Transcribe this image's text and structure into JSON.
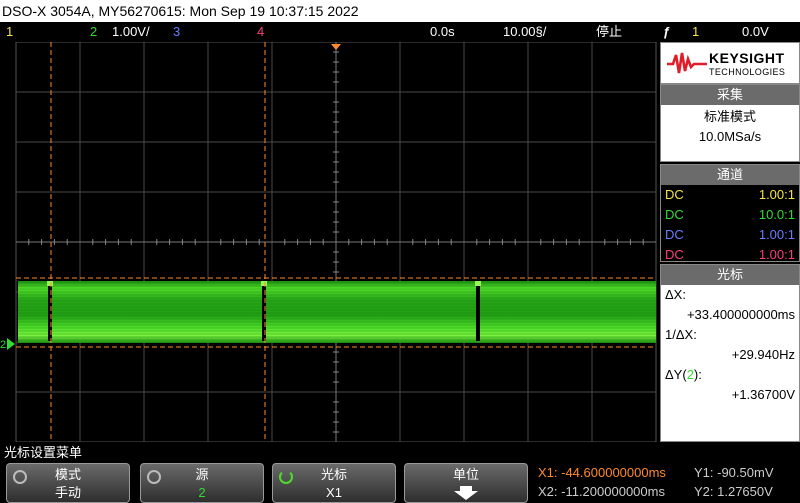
{
  "title_bar": "DSO-X 3054A, MY56270615: Mon Sep 19 10:37:15 2022",
  "status_bar": {
    "ch1": "1",
    "ch2": "2",
    "ch2_scale": "1.00V/",
    "ch3": "3",
    "ch4": "4",
    "delay": "0.0s",
    "timebase": "10.00§/",
    "run_state": "停止",
    "trigger_source": "1",
    "trigger_level": "0.0V"
  },
  "colors": {
    "ch1": "#f5e642",
    "ch2": "#2fdc2f",
    "ch3": "#6a7dff",
    "ch4": "#ff3c7f",
    "cursor": "#ff8a2a",
    "trigger_marker": "#ff8a2a"
  },
  "brand": {
    "name": "KEYSIGHT",
    "sub": "TECHNOLOGIES"
  },
  "acquisition": {
    "header": "采集",
    "mode": "标准模式",
    "rate": "10.0MSa/s"
  },
  "channels": {
    "header": "通道",
    "rows": [
      {
        "coupling": "DC",
        "probe": "1.00:1"
      },
      {
        "coupling": "DC",
        "probe": "10.0:1"
      },
      {
        "coupling": "DC",
        "probe": "1.00:1"
      },
      {
        "coupling": "DC",
        "probe": "1.00:1"
      }
    ]
  },
  "cursors": {
    "header": "光标",
    "dx_label": "ΔX:",
    "dx_value": "+33.400000000ms",
    "inv_dx_label": "1/ΔX:",
    "inv_dx_value": "+29.940Hz",
    "dy_label_prefix": "ΔY(",
    "dy_channel": "2",
    "dy_label_suffix": "):",
    "dy_value": "+1.36700V"
  },
  "menu_caption": "光标设置菜单",
  "softkeys": [
    {
      "label": "模式",
      "value": "手动",
      "icon": "rotate-knob-icon"
    },
    {
      "label": "源",
      "value": "2",
      "icon": "rotate-knob-icon"
    },
    {
      "label": "光标",
      "value": "X1",
      "icon": "rotate-knob-icon"
    },
    {
      "label": "单位",
      "value": "",
      "icon": "down-arrow-icon"
    }
  ],
  "cursor_readout": {
    "x1": "X1: -44.600000000ms",
    "x2": "X2: -11.200000000ms",
    "y1": "Y1: -90.50mV",
    "y2": "Y2: 1.27650V"
  },
  "ground_marker": "2"
}
